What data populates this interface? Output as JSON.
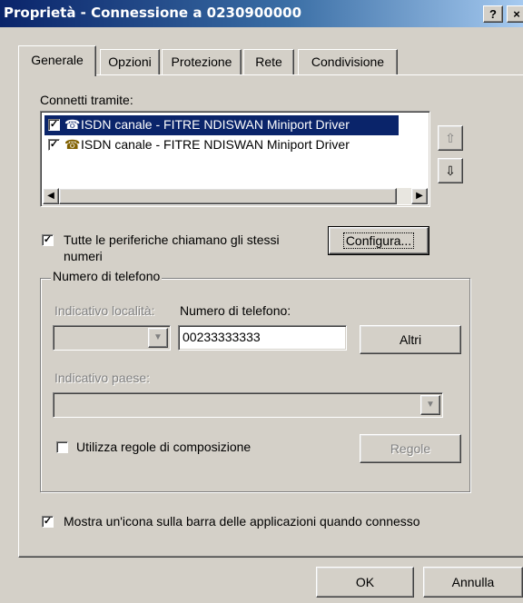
{
  "window": {
    "title": "Proprietà - Connessione a 0230900000",
    "help_label": "?",
    "close_label": "×"
  },
  "tabs": [
    {
      "label": "Generale",
      "active": true
    },
    {
      "label": "Opzioni"
    },
    {
      "label": "Protezione"
    },
    {
      "label": "Rete"
    },
    {
      "label": "Condivisione"
    }
  ],
  "connect_via": {
    "label": "Connetti tramite:",
    "devices": [
      {
        "name": "ISDN  canale - FITRE NDISWAN Miniport Driver",
        "checked": true,
        "selected": true
      },
      {
        "name": "ISDN  canale - FITRE NDISWAN Miniport Driver",
        "checked": true,
        "selected": false
      }
    ]
  },
  "same_numbers": {
    "label_line1": "Tutte le periferiche chiamano gli stessi",
    "label_line2": "numeri",
    "checked": true,
    "configure_label": "Configura..."
  },
  "phone_group": {
    "legend": "Numero di telefono",
    "area_code_label": "Indicativo località:",
    "area_code_value": "",
    "phone_label": "Numero di telefono:",
    "phone_value": "00233333333",
    "others_label": "Altri",
    "country_label": "Indicativo paese:",
    "country_value": "",
    "dial_rules_label": "Utilizza regole di composizione",
    "dial_rules_checked": false,
    "rules_button_label": "Regole"
  },
  "show_icon": {
    "label": "Mostra un'icona sulla barra delle applicazioni quando connesso",
    "checked": true
  },
  "footer": {
    "ok_label": "OK",
    "cancel_label": "Annulla"
  },
  "colors": {
    "title_bar": "#0a246a",
    "selection": "#0a246a",
    "face": "#d4d0c8"
  }
}
